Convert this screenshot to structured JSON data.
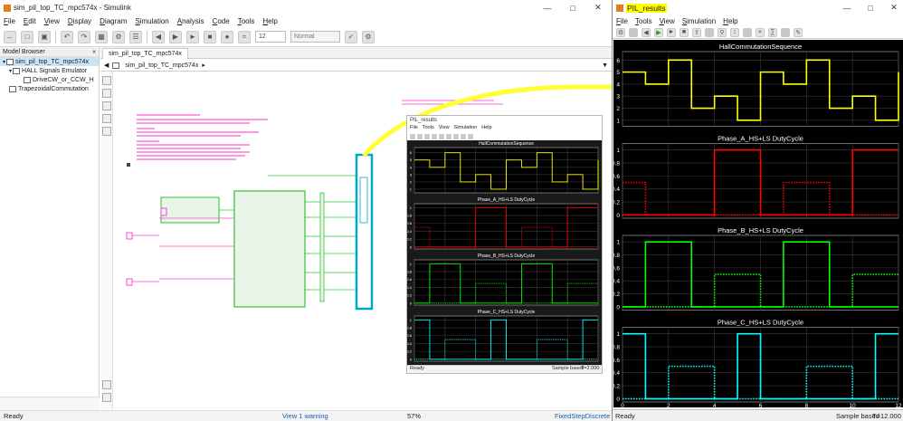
{
  "simulink": {
    "title": "sim_pil_top_TC_mpc574x - Simulink",
    "menu": [
      "File",
      "Edit",
      "View",
      "Display",
      "Diagram",
      "Simulation",
      "Analysis",
      "Code",
      "Tools",
      "Help"
    ],
    "toolbar": {
      "stop_time": "12",
      "sim_mode": "Normal"
    },
    "model_browser": {
      "header": "Model Browser",
      "items": [
        "sim_pil_top_TC_mpc574x",
        "HALL Signals Emulator",
        "DriveCW_or_CCW_H",
        "TrapezoidalCommutation"
      ]
    },
    "tab": "sim_pil_top_TC_mpc574x",
    "breadcrumb": "sim_pil_top_TC_mpc574x",
    "status": {
      "left": "Ready",
      "center": "View 1 warning",
      "zoom": "57%",
      "solver": "FixedStepDiscrete"
    }
  },
  "mini_scope": {
    "title": "PIL_results",
    "menu": [
      "File",
      "Tools",
      "View",
      "Simulation",
      "Help"
    ],
    "status_left": "Ready",
    "status_mid": "Sample based",
    "status_right": "T=2.000"
  },
  "pil_window": {
    "title": "PIL_results",
    "menu": [
      "File",
      "Tools",
      "View",
      "Simulation",
      "Help"
    ],
    "status": {
      "left": "Ready",
      "mid": "Sample based",
      "right": "T=12.000"
    },
    "colors": {
      "yellow": "#ffff00",
      "red": "#ff0000",
      "green": "#00ff00",
      "cyan": "#00ffff",
      "highlight": "#ffff00"
    }
  },
  "chart_data": [
    {
      "type": "line",
      "title": "HallCommutationSequence",
      "x_ticks": [
        "0",
        "2",
        "4",
        "6",
        "8",
        "10",
        "12"
      ],
      "y_ticks": [
        "1",
        "2",
        "3",
        "4",
        "5",
        "6"
      ],
      "xlim": [
        0,
        12
      ],
      "ylim": [
        0.5,
        6.7
      ],
      "series": [
        {
          "color": "#ffff00",
          "style": "step",
          "x": [
            0,
            1,
            2,
            3,
            4,
            5,
            6,
            7,
            8,
            9,
            10,
            11,
            12
          ],
          "y": [
            5,
            4,
            6,
            2,
            3,
            1,
            5,
            4,
            6,
            2,
            3,
            1,
            5
          ]
        }
      ]
    },
    {
      "type": "line",
      "title": "Phase_A_HS+LS DutyCycle",
      "x_ticks": [
        "0",
        "2",
        "4",
        "6",
        "8",
        "10",
        "12"
      ],
      "y_ticks": [
        "0",
        "0.2",
        "0.4",
        "0.6",
        "0.8",
        "1"
      ],
      "xlim": [
        0,
        12
      ],
      "ylim": [
        -0.05,
        1.1
      ],
      "series": [
        {
          "color": "#ff0000",
          "style": "step-solid",
          "x": [
            0,
            4,
            4,
            6,
            6,
            7,
            7,
            10,
            10,
            12
          ],
          "y": [
            0,
            0,
            1,
            1,
            0,
            0,
            0,
            0,
            1,
            1
          ]
        },
        {
          "color": "#ff0000",
          "style": "step-dotted",
          "x": [
            0,
            1,
            1,
            7,
            7,
            9,
            9,
            12
          ],
          "y": [
            0.5,
            0.5,
            0,
            0,
            0.5,
            0.5,
            0,
            0
          ]
        }
      ]
    },
    {
      "type": "line",
      "title": "Phase_B_HS+LS DutyCycle",
      "x_ticks": [
        "0",
        "2",
        "4",
        "6",
        "8",
        "10",
        "12"
      ],
      "y_ticks": [
        "0",
        "0.2",
        "0.4",
        "0.6",
        "0.8",
        "1"
      ],
      "xlim": [
        0,
        12
      ],
      "ylim": [
        -0.05,
        1.1
      ],
      "series": [
        {
          "color": "#00ff00",
          "style": "step-solid",
          "x": [
            0,
            1,
            1,
            3,
            3,
            7,
            7,
            9,
            9,
            12
          ],
          "y": [
            0,
            0,
            1,
            1,
            0,
            0,
            1,
            1,
            0,
            0
          ]
        },
        {
          "color": "#00ff00",
          "style": "step-dotted",
          "x": [
            0,
            4,
            4,
            6,
            6,
            10,
            10,
            12
          ],
          "y": [
            0,
            0,
            0.5,
            0.5,
            0,
            0,
            0.5,
            0.5
          ]
        }
      ]
    },
    {
      "type": "line",
      "title": "Phase_C_HS+LS DutyCycle",
      "x_ticks": [
        "0",
        "2",
        "4",
        "6",
        "8",
        "10",
        "12"
      ],
      "y_ticks": [
        "0",
        "0.2",
        "0.4",
        "0.6",
        "0.8",
        "1"
      ],
      "xlim": [
        0,
        12
      ],
      "ylim": [
        -0.05,
        1.1
      ],
      "series": [
        {
          "color": "#00ffff",
          "style": "step-solid",
          "x": [
            0,
            1,
            1,
            5,
            5,
            6,
            6,
            11,
            11,
            12
          ],
          "y": [
            1,
            1,
            0,
            0,
            1,
            1,
            0,
            0,
            1,
            1
          ]
        },
        {
          "color": "#00ffff",
          "style": "step-dotted",
          "x": [
            0,
            2,
            2,
            4,
            4,
            8,
            8,
            10,
            10,
            12
          ],
          "y": [
            0,
            0,
            0.5,
            0.5,
            0,
            0,
            0.5,
            0.5,
            0,
            0
          ]
        }
      ]
    }
  ]
}
